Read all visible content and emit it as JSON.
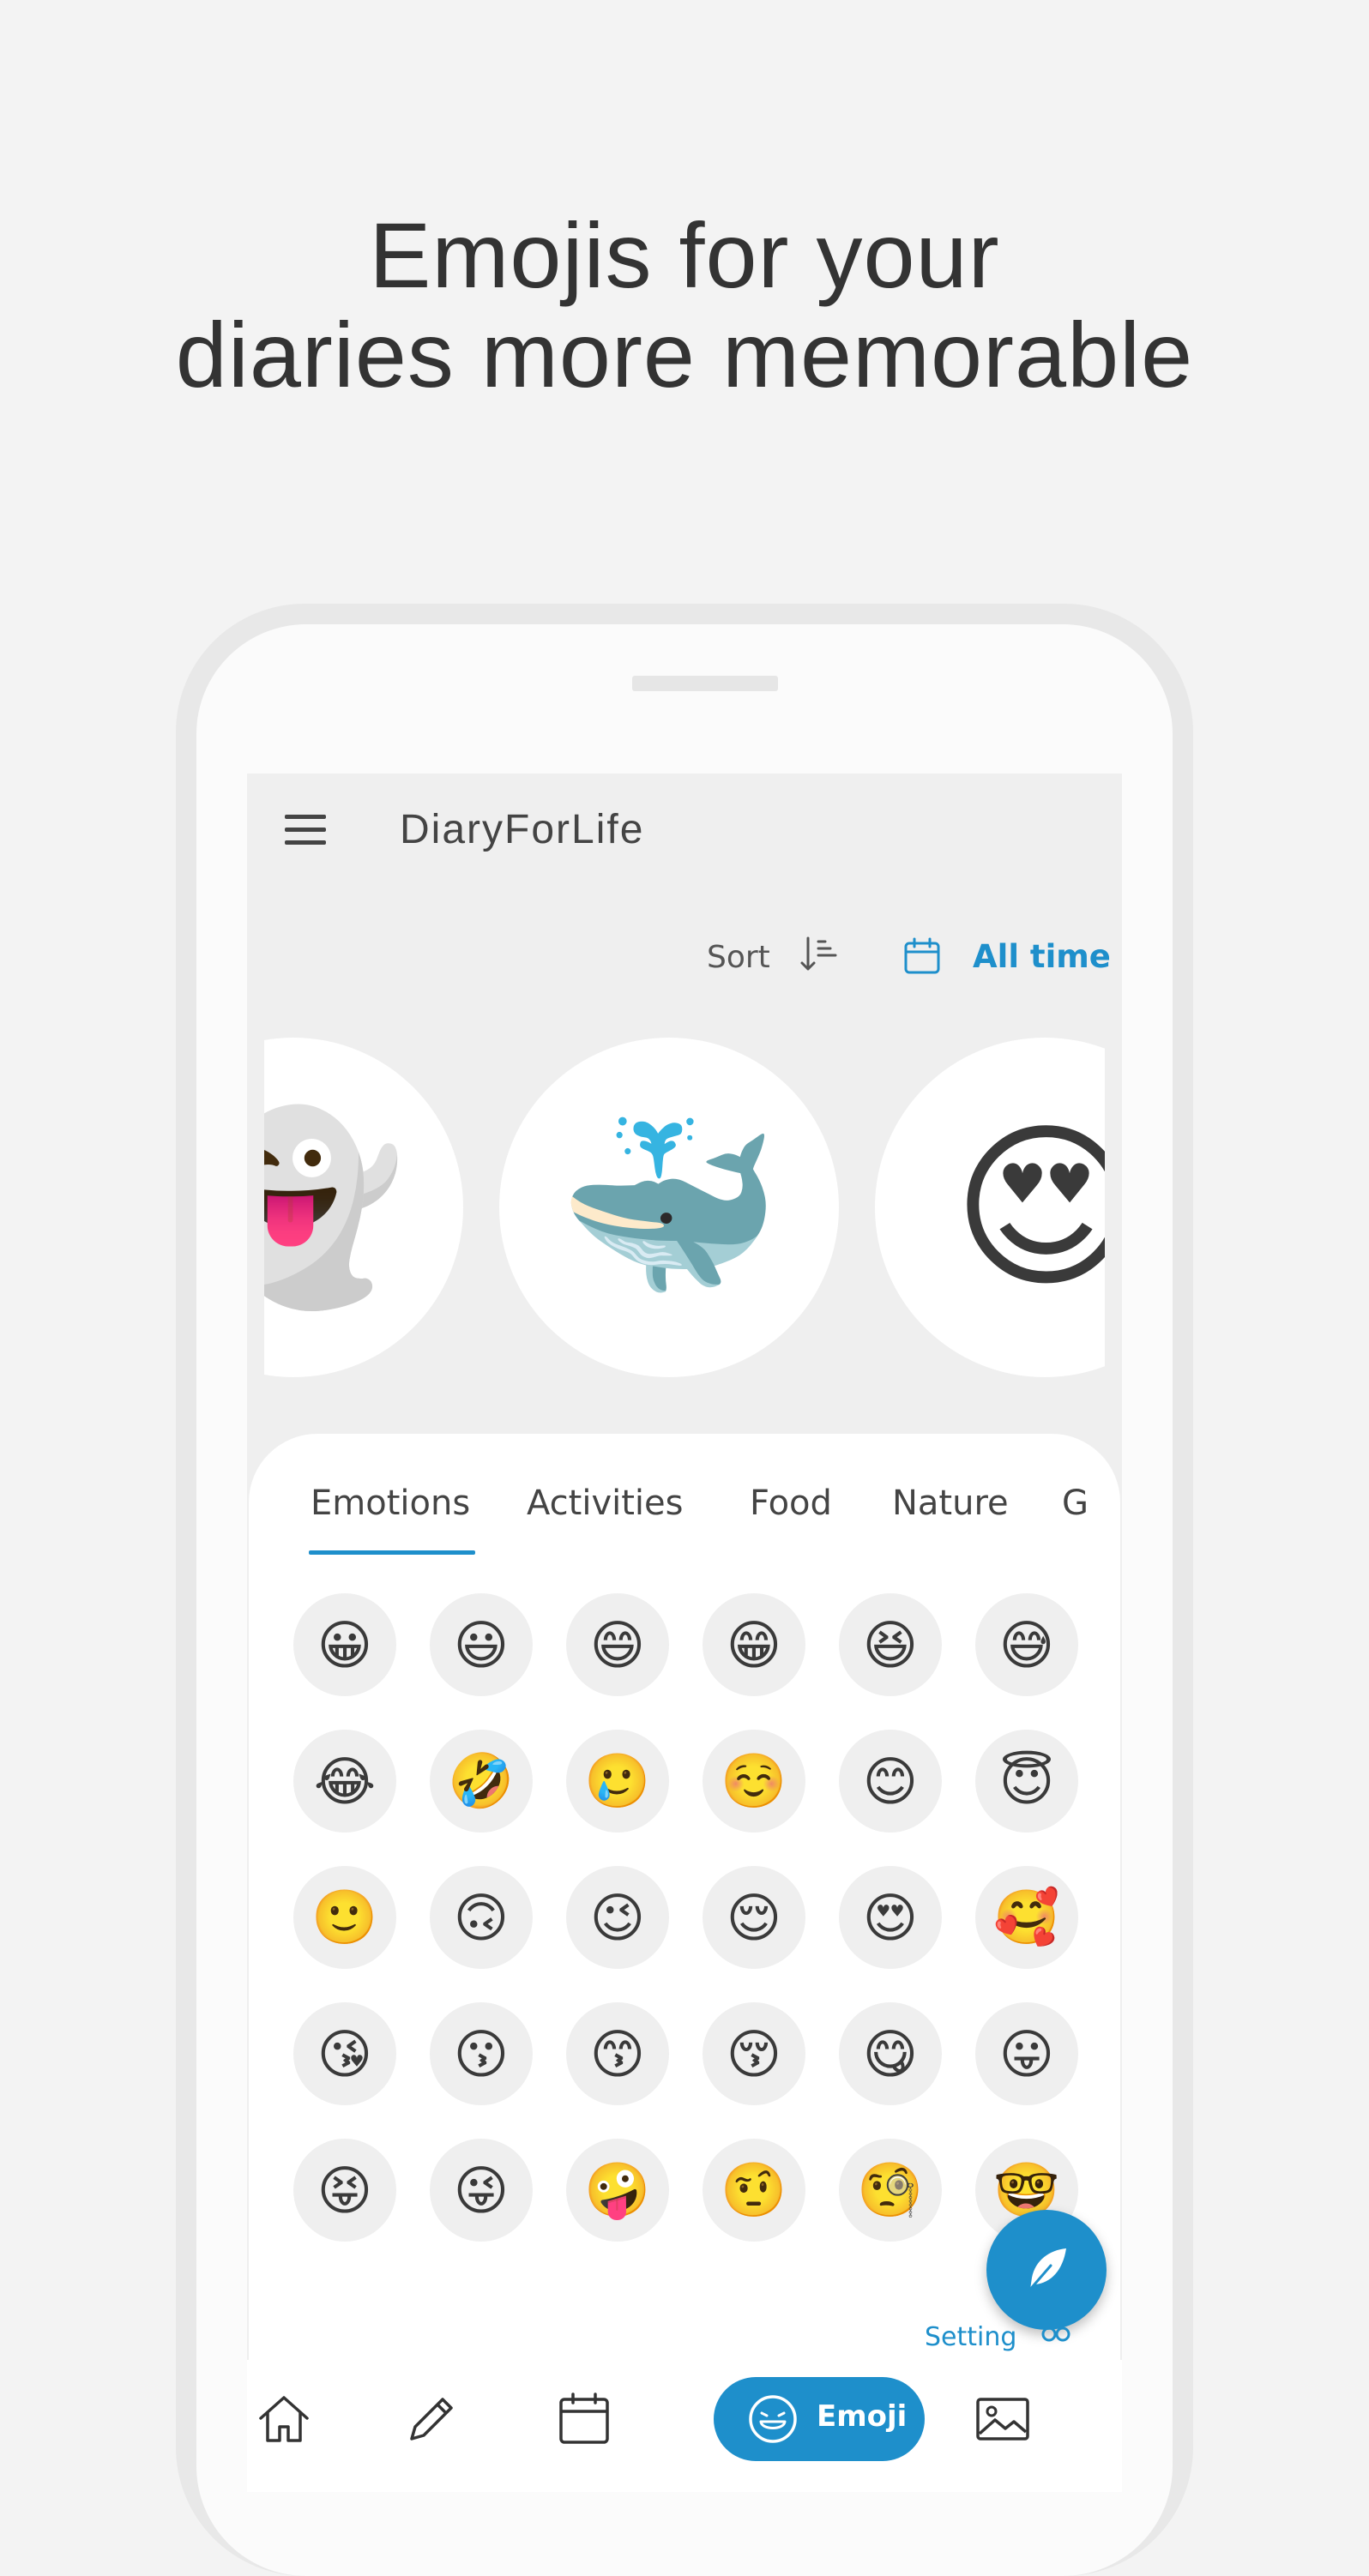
{
  "headline": {
    "line1": "Emojis for your",
    "line2": "diaries more memorable"
  },
  "app": {
    "title": "DiaryForLife",
    "sort_label": "Sort",
    "filter_label": "All time",
    "accent_color": "#1e8fcb"
  },
  "carousel": [
    "👻",
    "🐳",
    "😍"
  ],
  "tabs": [
    "Emotions",
    "Activities",
    "Food",
    "Nature",
    "G"
  ],
  "active_tab": "Emotions",
  "emoji_grid": [
    [
      "😀",
      "😃",
      "😄",
      "😁",
      "😆",
      "😅"
    ],
    [
      "😂",
      "🤣",
      "🥲",
      "☺️",
      "😊",
      "😇"
    ],
    [
      "🙂",
      "🙃",
      "😉",
      "😌",
      "😍",
      "🥰"
    ],
    [
      "😘",
      "😗",
      "😙",
      "😚",
      "😋",
      "😛"
    ],
    [
      "😝",
      "😜",
      "🤪",
      "🤨",
      "🧐",
      "🤓"
    ]
  ],
  "setting_label": "Setting",
  "bottom_nav": {
    "items": [
      "home-icon",
      "pencil-icon",
      "calendar-icon",
      "emoji-icon",
      "image-icon"
    ],
    "emoji_label": "Emoji"
  }
}
